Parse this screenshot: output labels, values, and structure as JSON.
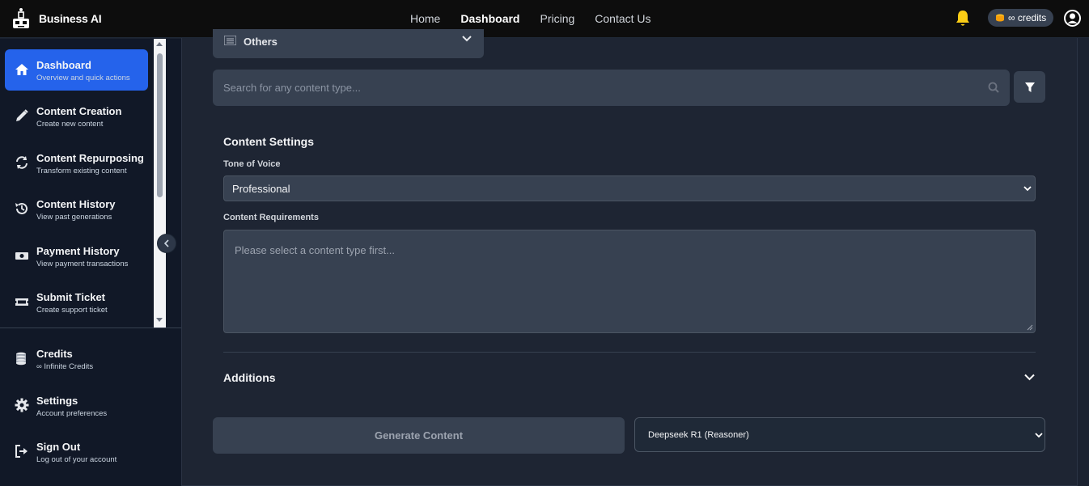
{
  "brand": {
    "name": "Business AI"
  },
  "nav": {
    "links": [
      {
        "label": "Home",
        "active": false
      },
      {
        "label": "Dashboard",
        "active": true
      },
      {
        "label": "Pricing",
        "active": false
      },
      {
        "label": "Contact Us",
        "active": false
      }
    ],
    "credits_label": "∞ credits",
    "icons": {
      "notifications": "bell-icon",
      "account": "user-circle-icon",
      "credits": "coins-icon"
    },
    "bell_color": "#facc15"
  },
  "sidebar": {
    "items": [
      {
        "title": "Dashboard",
        "subtitle": "Overview and quick actions",
        "icon": "home-icon",
        "active": true
      },
      {
        "title": "Content Creation",
        "subtitle": "Create new content",
        "icon": "pencil-icon",
        "active": false
      },
      {
        "title": "Content Repurposing",
        "subtitle": "Transform existing content",
        "icon": "refresh-icon",
        "active": false
      },
      {
        "title": "Content History",
        "subtitle": "View past generations",
        "icon": "history-icon",
        "active": false
      },
      {
        "title": "Payment History",
        "subtitle": "View payment transactions",
        "icon": "money-icon",
        "active": false
      },
      {
        "title": "Submit Ticket",
        "subtitle": "Create support ticket",
        "icon": "ticket-icon",
        "active": false
      }
    ],
    "bottom_items": [
      {
        "title": "Credits",
        "subtitle": "∞ Infinite Credits",
        "icon": "coins-icon"
      },
      {
        "title": "Settings",
        "subtitle": "Account preferences",
        "icon": "gear-icon"
      },
      {
        "title": "Sign Out",
        "subtitle": "Log out of your account",
        "icon": "sign-out-icon"
      }
    ],
    "active_color": "#2563eb"
  },
  "main": {
    "category_select": {
      "value": "Others"
    },
    "search": {
      "placeholder": "Search for any content type..."
    },
    "settings": {
      "title": "Content Settings",
      "tone_label": "Tone of Voice",
      "tone_value": "Professional",
      "requirements_label": "Content Requirements",
      "requirements_placeholder": "Please select a content type first..."
    },
    "additions": {
      "title": "Additions"
    },
    "generate_button": "Generate Content",
    "model_select": {
      "value": "Deepseek R1 (Reasoner)"
    }
  }
}
